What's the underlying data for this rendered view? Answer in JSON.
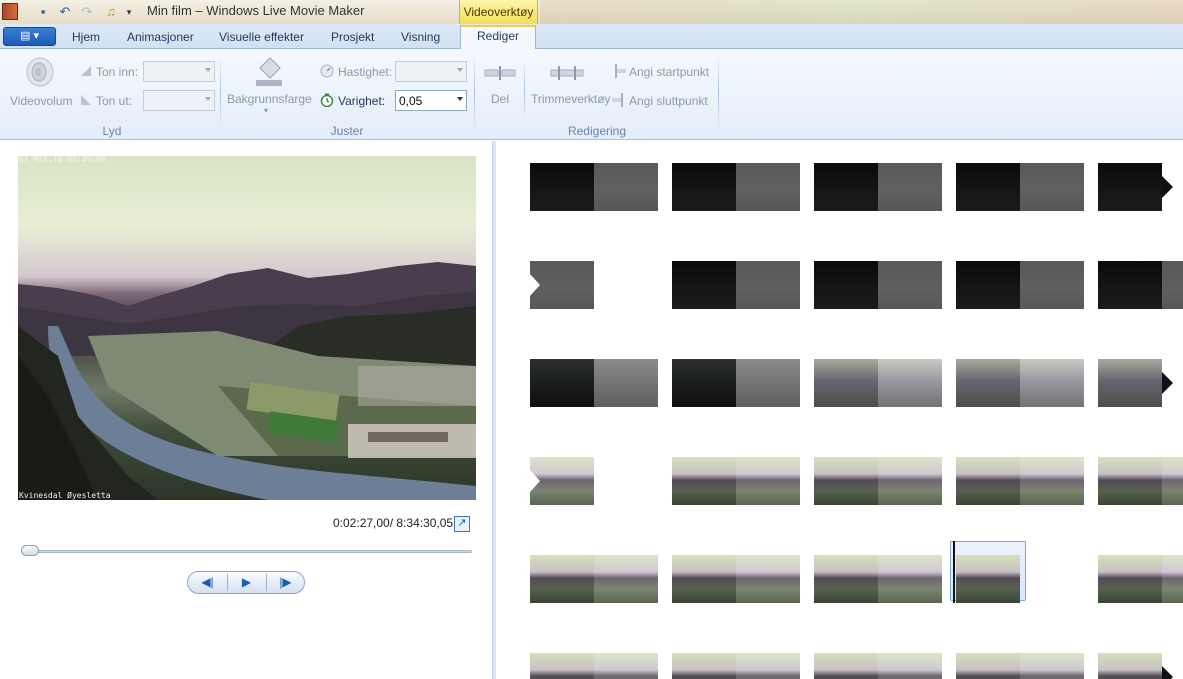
{
  "window": {
    "title": "Min film – Windows Live Movie Maker",
    "contextual_tab_group": "Videoverktøy"
  },
  "tabs": [
    {
      "label": "Hjem"
    },
    {
      "label": "Animasjoner"
    },
    {
      "label": "Visuelle effekter"
    },
    {
      "label": "Prosjekt"
    },
    {
      "label": "Visning"
    },
    {
      "label": "Rediger",
      "selected": true
    }
  ],
  "ribbon": {
    "lyd": {
      "group_title": "Lyd",
      "videovolum": "Videovolum",
      "ton_inn": "Ton inn:",
      "ton_ut": "Ton ut:"
    },
    "juster": {
      "group_title": "Juster",
      "bakgrunnsfarge": "Bakgrunnsfarge",
      "hastighet": "Hastighet:",
      "varighet": "Varighet:",
      "varighet_value": "0,05"
    },
    "redigering": {
      "group_title": "Redigering",
      "del": "Del",
      "trimmeverktoy": "Trimmeverktøy",
      "angi_startpunkt": "Angi startpunkt",
      "angi_sluttpunkt": "Angi sluttpunkt"
    }
  },
  "preview": {
    "osd_top": "01 MAY,10 05:45:00",
    "osd_bottom": "Kvinesdal Øyesletta",
    "timecode": "0:02:27,00/ 8:34:30,05",
    "seek_position": 0.005
  },
  "storyboard": {
    "rows": [
      [
        "night",
        "night",
        "night",
        "night",
        "night"
      ],
      [
        "night",
        "night",
        "night",
        "night",
        "night"
      ],
      [
        "dusk",
        "dusk",
        "dawn",
        "dawn",
        "dawn"
      ],
      [
        "day",
        "day",
        "day",
        "day",
        "day"
      ],
      [
        "day",
        "day",
        "day",
        "day",
        "day"
      ],
      [
        "day",
        "day",
        "day",
        "day",
        "day"
      ]
    ],
    "selected_clip": "row-5-clip-4"
  },
  "colors": {
    "accent": "#1d5bb5",
    "ribbon_bg": "#e3edf9",
    "context_tab": "#f2dc52"
  }
}
